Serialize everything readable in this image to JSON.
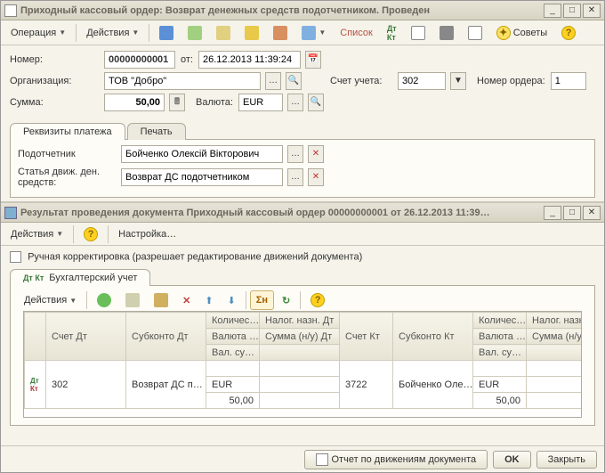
{
  "main": {
    "title": "Приходный кассовый ордер: Возврат денежных средств подотчетником. Проведен",
    "toolbar": {
      "operation": "Операция",
      "actions": "Действия",
      "list": "Список",
      "tips": "Советы"
    },
    "form": {
      "number_label": "Номер:",
      "number": "00000000001",
      "from_label": "от:",
      "date": "26.12.2013 11:39:24",
      "org_label": "Организация:",
      "org": "ТОВ \"Добро\"",
      "account_label": "Счет учета:",
      "account": "302",
      "orderno_label": "Номер ордера:",
      "orderno": "1",
      "sum_label": "Сумма:",
      "sum": "50,00",
      "currency_label": "Валюта:",
      "currency": "EUR"
    },
    "tabs": {
      "t1": "Реквизиты платежа",
      "t2": "Печать"
    },
    "tabbody": {
      "accperson_label": "Подотчетник",
      "accperson": "Бойченко Олексій Вікторович",
      "cashflow_label1": "Статья движ. ден.",
      "cashflow_label2": "средств:",
      "cashflow": "Возврат ДС подотчетником"
    }
  },
  "sub": {
    "title": "Результат проведения документа Приходный кассовый ордер 00000000001 от 26.12.2013 11:39…",
    "toolbar": {
      "actions": "Действия",
      "settings": "Настройка…"
    },
    "manual": "Ручная корректировка (разрешает редактирование движений документа)",
    "tab": "Бухгалтерский учет",
    "grid_toolbar": {
      "actions": "Действия"
    },
    "headers": {
      "c1": "",
      "c2": "Счет Дт",
      "c3": "Субконто Дт",
      "c4": "Количес…",
      "c4b": "Валюта …",
      "c4c": "Вал. су…",
      "c5": "Налог. назн. Дт",
      "c5b": "Сумма (н/у) Дт",
      "c6": "Счет Кт",
      "c7": "Субконто Кт",
      "c8": "Количес…",
      "c8b": "Валюта …",
      "c8c": "Вал. су…",
      "c9": "Налог. назн",
      "c9b": "Сумма (н/у)"
    },
    "row": {
      "mark": "Дт Кт",
      "acc_dt": "302",
      "sub_dt": "Возврат ДС п…",
      "cur_dt": "EUR",
      "amt_dt": "50,00",
      "acc_kt": "3722",
      "sub_kt": "Бойченко Оле…",
      "cur_kt": "EUR",
      "amt_kt": "50,00"
    }
  },
  "footer": {
    "report": "Отчет по движениям документа",
    "ok": "OK",
    "close": "Закрыть"
  }
}
